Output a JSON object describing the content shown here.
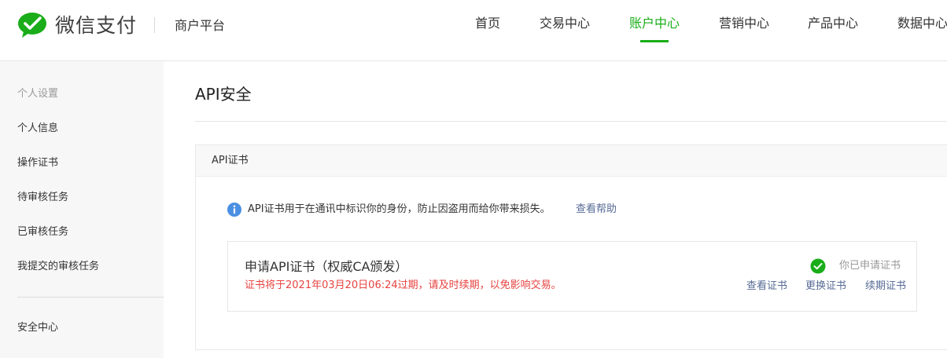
{
  "header": {
    "brand": "微信支付",
    "platform": "商户平台",
    "nav": [
      {
        "label": "首页",
        "active": false
      },
      {
        "label": "交易中心",
        "active": false
      },
      {
        "label": "账户中心",
        "active": true
      },
      {
        "label": "营销中心",
        "active": false
      },
      {
        "label": "产品中心",
        "active": false
      },
      {
        "label": "数据中心",
        "active": false
      }
    ]
  },
  "sidebar": {
    "section_title": "个人设置",
    "items": [
      {
        "label": "个人信息"
      },
      {
        "label": "操作证书"
      },
      {
        "label": "待审核任务"
      },
      {
        "label": "已审核任务"
      },
      {
        "label": "我提交的审核任务"
      }
    ],
    "security_center": "安全中心"
  },
  "main": {
    "title": "API安全",
    "panel": {
      "heading": "API证书",
      "info_text": "API证书用于在通讯中标识你的身份，防止因盗用而给你带来损失。",
      "info_link": "查看帮助",
      "cert": {
        "title": "申请API证书（权威CA颁发）",
        "warning": "证书将于2021年03月20日06:24过期，请及时续期，以免影响交易。",
        "status": "你已申请证书",
        "actions": [
          {
            "label": "查看证书"
          },
          {
            "label": "更换证书"
          },
          {
            "label": "续期证书"
          }
        ]
      }
    }
  },
  "colors": {
    "brand_green": "#1aad19",
    "link_blue": "#576b95",
    "warning_red": "#e64340",
    "info_blue": "#4a90e2",
    "success_green": "#1aad19"
  },
  "icons": {
    "logo": "wechat-pay-logo",
    "info": "info-icon",
    "status": "check-circle-icon"
  }
}
